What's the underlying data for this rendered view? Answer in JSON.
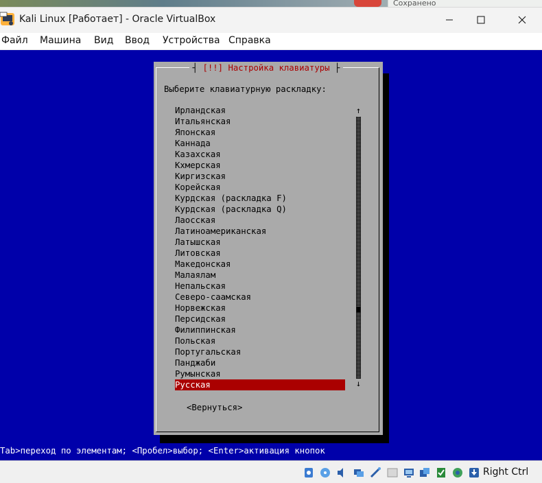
{
  "window": {
    "title": "Kali Linux [Работает] - Oracle VirtualBox",
    "partial_tab_text": "Сохранено",
    "minimize_icon": "minimize-icon",
    "maximize_icon": "maximize-icon",
    "close_icon": "close-icon"
  },
  "menu": [
    "Файл",
    "Машина",
    "Вид",
    "Ввод",
    "Устройства",
    "Справка"
  ],
  "installer": {
    "dialog_title": "[!!] Настройка клавиатуры",
    "prompt": "Выберите клавиатурную раскладку:",
    "layouts": [
      "Ирландская",
      "Итальянская",
      "Японская",
      "Каннада",
      "Казахская",
      "Кхмерская",
      "Киргизская",
      "Корейская",
      "Курдская (раскладка F)",
      "Курдская (раскладка Q)",
      "Лаосская",
      "Латиноамериканская",
      "Латышская",
      "Литовская",
      "Македонская",
      "Малаялам",
      "Непальская",
      "Северо-саамская",
      "Норвежская",
      "Персидская",
      "Филиппинская",
      "Польская",
      "Португальская",
      "Панджаби",
      "Румынская",
      "Русская"
    ],
    "selected_index": 25,
    "back_button": "<Вернуться>",
    "help_line": "Tab>переход по элементам; <Пробел>выбор; <Enter>активация кнопок"
  },
  "statusbar": {
    "host_key": "Right Ctrl",
    "icons": [
      "hdd-icon",
      "optical-drive-icon",
      "audio-icon",
      "network-icon",
      "usb-icon",
      "shared-folders-icon",
      "display-icon",
      "recording-icon",
      "mouse-integration-icon",
      "cpu-icon",
      "keyboard-icon"
    ]
  },
  "colors": {
    "vm_background": "#0000aa",
    "dialog_background": "#aaaaaa",
    "selection": "#aa0000",
    "title_text": "#aa0000"
  }
}
